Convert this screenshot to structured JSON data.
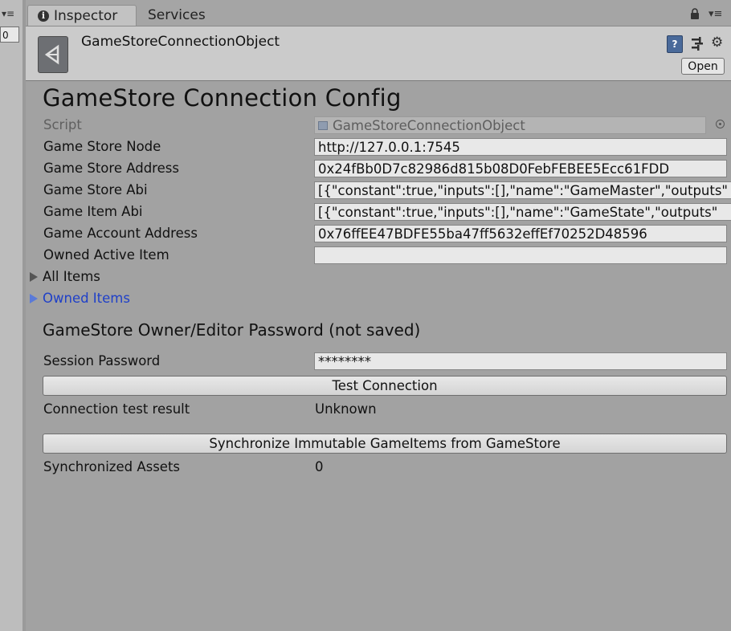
{
  "left_panel": {
    "menu_glyph": "▾≡",
    "field_value": "0"
  },
  "tabs": [
    {
      "label": "Inspector",
      "icon": "info-icon"
    },
    {
      "label": "Services"
    }
  ],
  "tab_menu_glyph": "▾≡",
  "header": {
    "object_name": "GameStoreConnectionObject",
    "open_label": "Open",
    "help_glyph": "?",
    "gear_glyph": "⚙"
  },
  "inspector": {
    "title": "GameStore Connection Config",
    "script": {
      "label": "Script",
      "value": "GameStoreConnectionObject"
    },
    "fields": [
      {
        "label": "Game Store Node",
        "value": "http://127.0.0.1:7545"
      },
      {
        "label": "Game Store Address",
        "value": "0x24fBb0D7c82986d815b08D0FebFEBEE5Ecc61FDD"
      },
      {
        "label": "Game Store Abi",
        "value": "[{\"constant\":true,\"inputs\":[],\"name\":\"GameMaster\",\"outputs\""
      },
      {
        "label": "Game Item Abi",
        "value": "[{\"constant\":true,\"inputs\":[],\"name\":\"GameState\",\"outputs\""
      },
      {
        "label": "Game Account Address",
        "value": "0x76ffEE47BDFE55ba47ff5632effEf70252D48596"
      },
      {
        "label": "Owned Active Item",
        "value": ""
      }
    ],
    "foldouts": [
      {
        "label": "All Items"
      },
      {
        "label": "Owned Items"
      }
    ],
    "password_section": {
      "title": "GameStore Owner/Editor Password (not saved)",
      "label": "Session Password",
      "value": "********"
    },
    "test_button": "Test Connection",
    "result": {
      "label": "Connection test result",
      "value": "Unknown"
    },
    "sync_button": "Synchronize Immutable GameItems from GameStore",
    "synced": {
      "label": "Synchronized Assets",
      "value": "0"
    }
  }
}
